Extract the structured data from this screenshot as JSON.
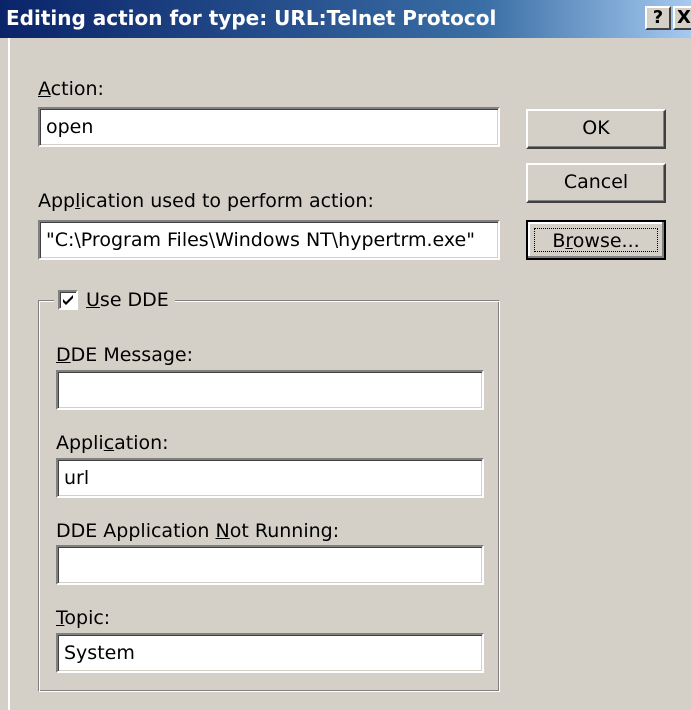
{
  "window": {
    "title": "Editing action for type: URL:Telnet Protocol",
    "help_glyph": "?",
    "close_glyph": "X"
  },
  "action": {
    "label": "Action:",
    "value": "open"
  },
  "application": {
    "label": "Application used to perform action:",
    "value": "\"C:\\Program Files\\Windows NT\\hypertrm.exe\""
  },
  "buttons": {
    "ok": "OK",
    "cancel": "Cancel",
    "browse": "Browse..."
  },
  "dde": {
    "checkbox_label": "Use DDE",
    "checked": true,
    "message": {
      "label": "DDE Message:",
      "value": ""
    },
    "application": {
      "label": "Application:",
      "value": "url"
    },
    "not_running": {
      "label": "DDE Application Not Running:",
      "value": ""
    },
    "topic": {
      "label": "Topic:",
      "value": "System"
    }
  }
}
